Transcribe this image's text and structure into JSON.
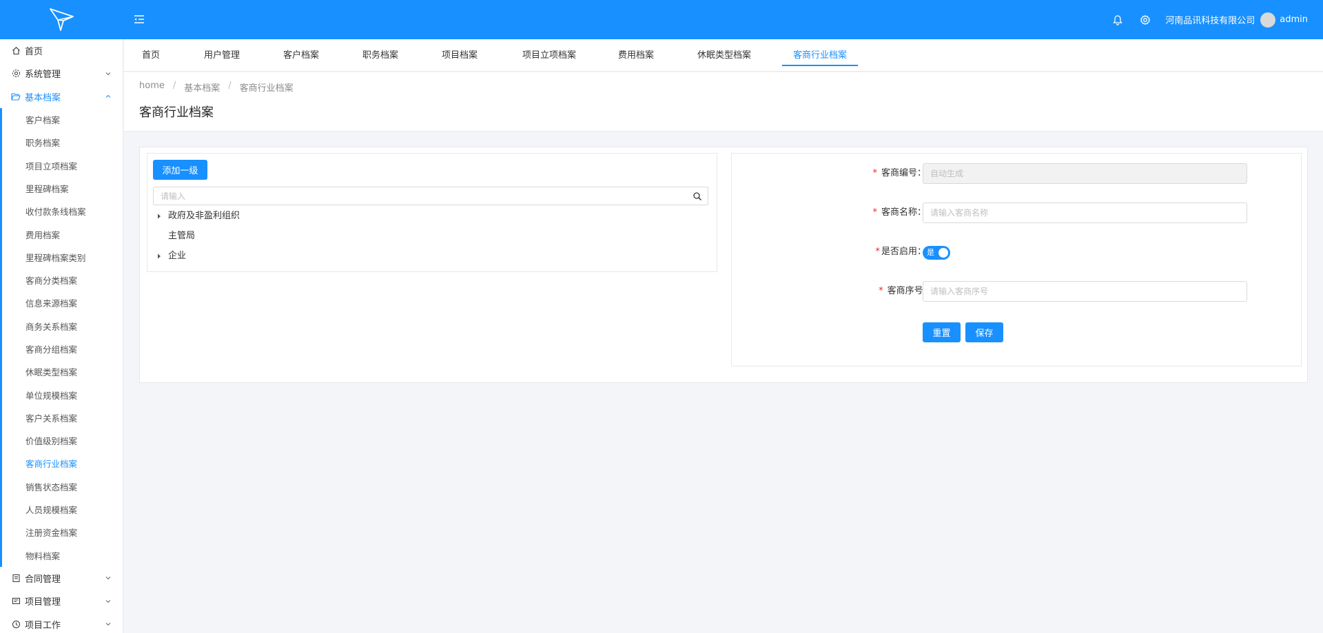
{
  "header": {
    "company": "河南品讯科技有限公司",
    "user": "admin",
    "bell_icon": "bell-icon",
    "settings_icon": "gear-icon",
    "accent": "#1890ff"
  },
  "sidebar": {
    "items": [
      {
        "label": "首页",
        "icon": "home-icon"
      },
      {
        "label": "系统管理",
        "icon": "gear-icon",
        "expandable": true
      },
      {
        "label": "基本档案",
        "icon": "folder-open-icon",
        "expanded": true
      }
    ],
    "submenu": [
      "客户档案",
      "职务档案",
      "项目立项档案",
      "里程碑档案",
      "收付款条线档案",
      "费用档案",
      "里程碑档案类别",
      "客商分类档案",
      "信息来源档案",
      "商务关系档案",
      "客商分组档案",
      "休眠类型档案",
      "单位规模档案",
      "客户关系档案",
      "价值级别档案",
      "客商行业档案",
      "销售状态档案",
      "人员规模档案",
      "注册资金档案",
      "物料档案"
    ],
    "active_sub": "客商行业档案",
    "bottom_items": [
      {
        "label": "合同管理",
        "icon": "contract-icon"
      },
      {
        "label": "项目管理",
        "icon": "project-icon"
      },
      {
        "label": "项目工作",
        "icon": "clock-icon"
      }
    ]
  },
  "tabs": [
    "首页",
    "用户管理",
    "客户档案",
    "职务档案",
    "项目档案",
    "项目立项档案",
    "费用档案",
    "休眠类型档案",
    "客商行业档案"
  ],
  "active_tab": "客商行业档案",
  "breadcrumb": {
    "home": "home",
    "level1": "基本档案",
    "level2": "客商行业档案",
    "sep": "/"
  },
  "page_title": "客商行业档案",
  "tree": {
    "add_button": "添加一级",
    "search_placeholder": "请输入",
    "nodes": [
      {
        "label": "政府及非盈利组织",
        "expandable": true
      },
      {
        "label": "主管局",
        "expandable": false
      },
      {
        "label": "企业",
        "expandable": true
      }
    ]
  },
  "form": {
    "code": {
      "label": "客商编号：",
      "placeholder": "自动生成"
    },
    "name": {
      "label": "客商名称：",
      "placeholder": "请输入客商名称"
    },
    "enabled": {
      "label": "是否启用：",
      "value": "是",
      "on": true
    },
    "order": {
      "label": "客商序号:",
      "placeholder": "请输入客商序号"
    },
    "required_mark": "*",
    "reset_button": "重置",
    "save_button": "保存"
  }
}
